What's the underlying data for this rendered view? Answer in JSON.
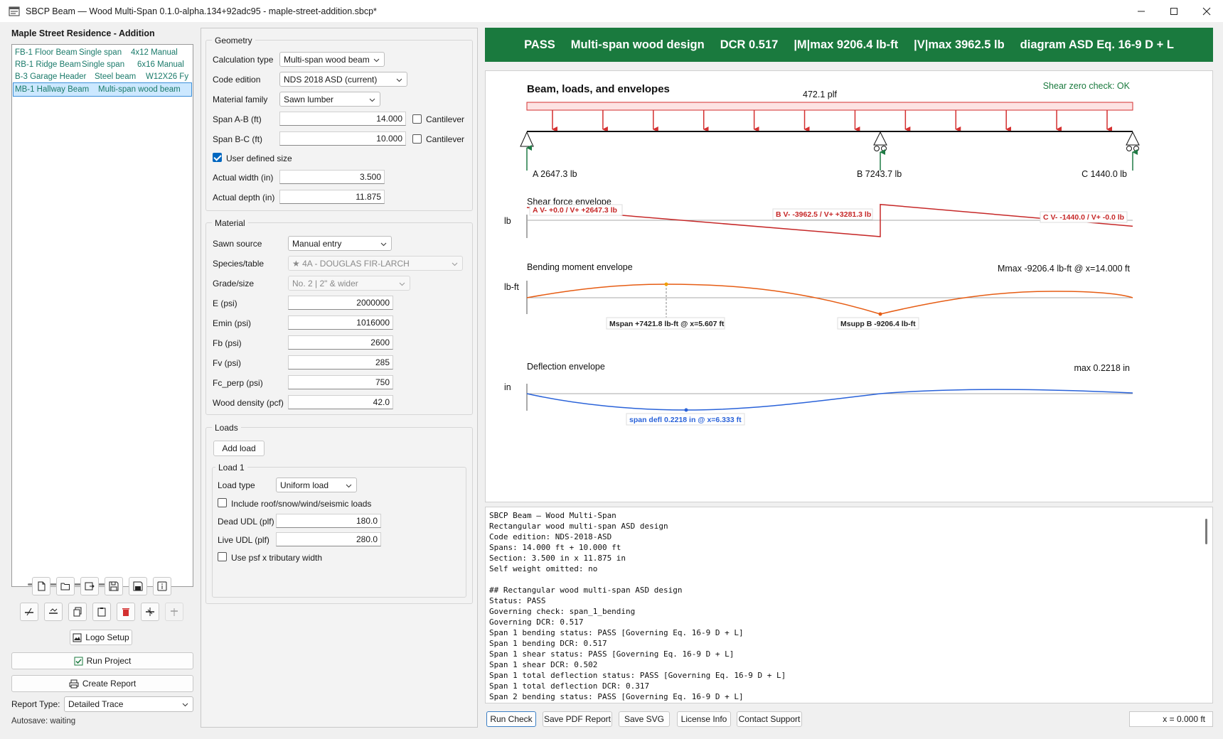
{
  "window": {
    "title": "SBCP Beam — Wood Multi-Span 0.1.0-alpha.134+92adc95 - maple-street-addition.sbcp*"
  },
  "project": {
    "title": "Maple Street Residence - Addition",
    "beams": [
      {
        "name": "FB-1 Floor Beam",
        "type": "Single span",
        "section": "4x12 Manual"
      },
      {
        "name": "RB-1 Ridge Beam",
        "type": "Single span",
        "section": "6x16 Manual"
      },
      {
        "name": "B-3 Garage Header",
        "type": "Steel beam",
        "section": "W12X26 Fy"
      },
      {
        "name": "MB-1 Hallway Beam",
        "type": "Multi-span wood beam",
        "section": ""
      }
    ],
    "selected_index": 3
  },
  "left_actions": {
    "logo_setup": "Logo Setup",
    "run_project": "Run Project",
    "create_report": "Create Report",
    "report_type_label": "Report Type:",
    "report_type_value": "Detailed Trace",
    "autosave": "Autosave: waiting"
  },
  "geometry": {
    "group_title": "Geometry",
    "calc_type_label": "Calculation type",
    "calc_type_value": "Multi-span wood beam",
    "code_edition_label": "Code edition",
    "code_edition_value": "NDS 2018 ASD (current)",
    "material_family_label": "Material family",
    "material_family_value": "Sawn lumber",
    "span_ab_label": "Span A-B (ft)",
    "span_ab_value": "14.000",
    "span_bc_label": "Span B-C (ft)",
    "span_bc_value": "10.000",
    "cantilever_label": "Cantilever",
    "user_defined_label": "User defined size",
    "user_defined_checked": true,
    "width_label": "Actual width (in)",
    "width_value": "3.500",
    "depth_label": "Actual depth (in)",
    "depth_value": "11.875"
  },
  "material": {
    "group_title": "Material",
    "source_label": "Sawn source",
    "source_value": "Manual entry",
    "species_label": "Species/table",
    "species_value": "★ 4A - DOUGLAS FIR-LARCH",
    "grade_label": "Grade/size",
    "grade_value": "No. 2 | 2\" & wider",
    "e_label": "E (psi)",
    "e_value": "2000000",
    "emin_label": "Emin (psi)",
    "emin_value": "1016000",
    "fb_label": "Fb (psi)",
    "fb_value": "2600",
    "fv_label": "Fv (psi)",
    "fv_value": "285",
    "fcp_label": "Fc_perp (psi)",
    "fcp_value": "750",
    "density_label": "Wood density (pcf)",
    "density_value": "42.0"
  },
  "loads": {
    "group_title": "Loads",
    "add_load": "Add load",
    "load1_title": "Load 1",
    "load_type_label": "Load type",
    "load_type_value": "Uniform load",
    "include_label": "Include roof/snow/wind/seismic loads",
    "dead_label": "Dead UDL (plf)",
    "dead_value": "180.0",
    "live_label": "Live UDL (plf)",
    "live_value": "280.0",
    "psf_label": "Use psf x tributary width"
  },
  "status": {
    "result": "PASS",
    "design": "Multi-span wood design",
    "dcr": "DCR 0.517",
    "mmax": "|M|max 9206.4 lb-ft",
    "vmax": "|V|max 3962.5 lb",
    "diagram": "diagram ASD Eq. 16-9 D + L"
  },
  "diagram": {
    "title": "Beam, loads, and envelopes",
    "shear_check": "Shear zero check: OK",
    "udl_label": "472.1 plf",
    "reaction_a": "A 2647.3 lb",
    "reaction_b": "B 7243.7 lb",
    "reaction_c": "C 1440.0 lb",
    "shear_title": "Shear force envelope",
    "shear_unit": "lb",
    "shear_a": "A V- +0.0 / V+ +2647.3 lb",
    "shear_b": "B V- -3962.5 / V+ +3281.3 lb",
    "shear_c": "C V- -1440.0 / V+ -0.0 lb",
    "moment_title": "Bending moment envelope",
    "moment_unit": "lb-ft",
    "moment_max": "Mmax -9206.4 lb-ft @ x=14.000 ft",
    "moment_span": "Mspan +7421.8 lb-ft @ x=5.607 ft",
    "moment_supp": "Msupp B -9206.4 lb-ft",
    "defl_title": "Deflection envelope",
    "defl_unit": "in",
    "defl_max": "max 0.2218 in",
    "defl_span": "span defl 0.2218 in @ x=6.333 ft",
    "spans_ft": [
      14.0,
      10.0
    ],
    "w_plf": 472.1,
    "shear_points": [
      {
        "x": 0,
        "v": 2647.3
      },
      {
        "x": 14,
        "v": -3962.5
      },
      {
        "x": 14,
        "v": 3281.3
      },
      {
        "x": 24,
        "v": -1440.0
      }
    ]
  },
  "trace": [
    "SBCP Beam — Wood Multi-Span",
    "Rectangular wood multi-span ASD design",
    "Code edition: NDS-2018-ASD",
    "Spans: 14.000 ft + 10.000 ft",
    "Section: 3.500 in x 11.875 in",
    "Self weight omitted: no",
    "",
    "## Rectangular wood multi-span ASD design",
    "Status: PASS",
    "Governing check: span_1_bending",
    "Governing DCR: 0.517",
    "Span 1 bending status: PASS [Governing Eq. 16-9 D + L]",
    "Span 1 bending DCR: 0.517",
    "Span 1 shear status: PASS [Governing Eq. 16-9 D + L]",
    "Span 1 shear DCR: 0.502",
    "Span 1 total deflection status: PASS [Governing Eq. 16-9 D + L]",
    "Span 1 total deflection DCR: 0.317",
    "Span 2 bending status: PASS [Governing Eq. 16-9 D + L]"
  ],
  "bottom": {
    "run_check": "Run Check",
    "save_pdf": "Save PDF Report",
    "save_svg": "Save SVG",
    "license": "License Info",
    "support": "Contact Support",
    "x_readout": "x = 0.000 ft"
  },
  "colors": {
    "pass_green": "#1a7a3e",
    "load_red": "#d32f2f",
    "shear_red": "#c62828",
    "moment_orange": "#e65c13",
    "defl_blue": "#2962d9",
    "reaction_green": "#1f7a45"
  }
}
